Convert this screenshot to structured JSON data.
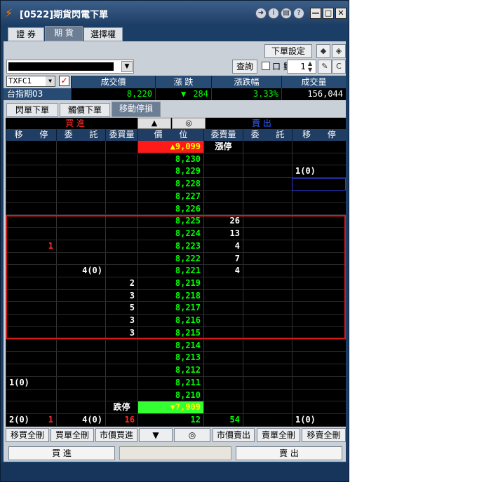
{
  "window": {
    "title": "[0522]期貨閃電下單",
    "app_icon": "lightning-icon"
  },
  "top_tabs": [
    {
      "label": "證 券",
      "active": false
    },
    {
      "label": "期 貨",
      "active": true
    },
    {
      "label": "選擇權",
      "active": false
    }
  ],
  "toolbar": {
    "order_settings": "下單設定",
    "query": "查詢",
    "lots_label": "口 數",
    "lots_value": "1",
    "c_label": "C",
    "account_value": ""
  },
  "symbol": {
    "code": "TXFC1",
    "name": "台指期03"
  },
  "quote": {
    "headers": [
      "成交價",
      "漲 跌",
      "漲跌幅",
      "成交量"
    ],
    "price": "8,220",
    "change_arrow": "▼",
    "change": "284",
    "change_pct": "3.33%",
    "volume": "156,044"
  },
  "sub_tabs": [
    {
      "label": "閃單下單",
      "active": false
    },
    {
      "label": "觸價下單",
      "active": false
    },
    {
      "label": "移動停損",
      "active": true
    }
  ],
  "ladder_top": {
    "buy_label": "買 進",
    "up_arrow": "▲",
    "center_mark": "◎",
    "sell_label": "賣 出"
  },
  "ladder_headers": [
    "移 停",
    "委 託",
    "委買量",
    "價 位",
    "委賣量",
    "委 託",
    "移 停"
  ],
  "ladder_rows": [
    {
      "price": "▲9,099",
      "price_style": "limit-up",
      "sell_qty": "漲停"
    },
    {
      "price": "8,230"
    },
    {
      "price": "8,229",
      "sell_stop": "1(0)"
    },
    {
      "price": "8,228"
    },
    {
      "price": "8,227"
    },
    {
      "price": "8,226"
    },
    {
      "price": "8,225",
      "sell_qty": "26"
    },
    {
      "price": "8,224",
      "sell_qty": "13"
    },
    {
      "price": "8,223",
      "buy_stop": "1",
      "sell_qty": "4"
    },
    {
      "price": "8,222",
      "sell_qty": "7"
    },
    {
      "price": "8,221",
      "buy_order": "4(0)",
      "sell_qty": "4"
    },
    {
      "price": "8,219",
      "buy_qty": "2"
    },
    {
      "price": "8,218",
      "buy_qty": "3"
    },
    {
      "price": "8,217",
      "buy_qty": "5"
    },
    {
      "price": "8,216",
      "buy_qty": "3"
    },
    {
      "price": "8,215",
      "buy_qty": "3"
    },
    {
      "price": "8,214"
    },
    {
      "price": "8,213"
    },
    {
      "price": "8,212"
    },
    {
      "price": "8,211",
      "buy_stop_left": "1(0)"
    },
    {
      "price": "8,210"
    },
    {
      "price": "▼7,909",
      "price_style": "limit-down",
      "buy_qty": "跌停"
    }
  ],
  "ladder_footer": {
    "buy_stop_total": "2(0)",
    "buy_stop_red": "1",
    "buy_order_total": "4(0)",
    "buy_qty_total": "16",
    "center_total": "12",
    "sell_qty_total": "54",
    "sell_stop_total": "1(0)"
  },
  "action_buttons": [
    "移買全刪",
    "買單全刪",
    "市價買進",
    "▼",
    "◎",
    "市價賣出",
    "賣單全刪",
    "移賣全刪"
  ],
  "bottom": {
    "buy": "買 進",
    "sell": "賣 出"
  }
}
